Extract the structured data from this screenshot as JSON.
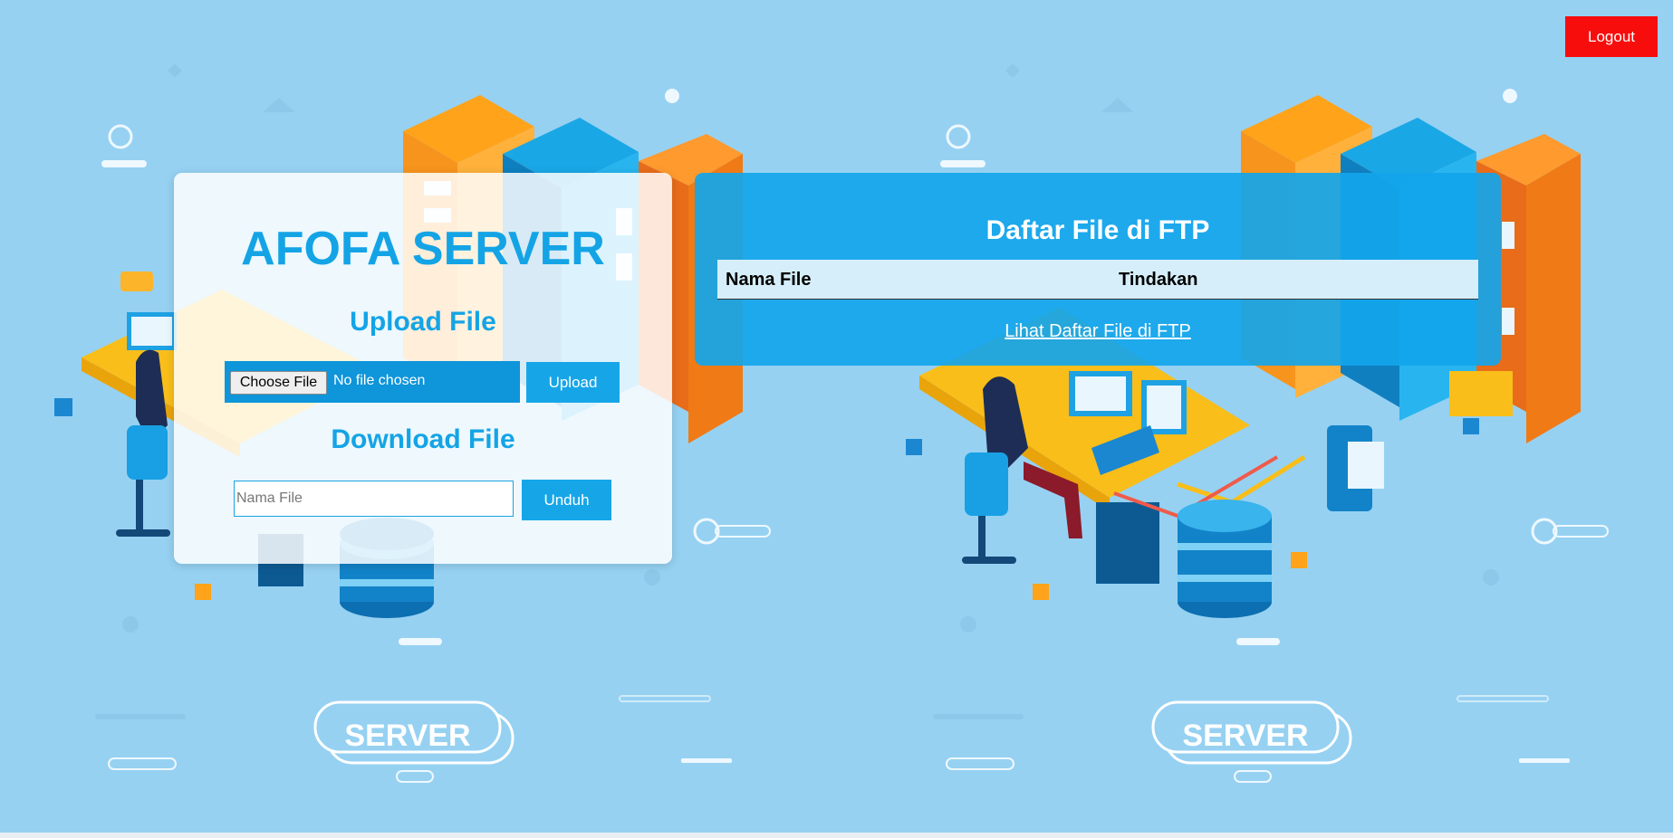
{
  "header": {
    "logout_label": "Logout"
  },
  "upload_panel": {
    "app_title": "AFOFA SERVER",
    "upload_title": "Upload File",
    "choose_file_label": "Choose File",
    "file_status": "No file chosen",
    "upload_button": "Upload",
    "download_title": "Download File",
    "filename_placeholder": "Nama File",
    "download_button": "Unduh"
  },
  "file_list_panel": {
    "title": "Daftar File di FTP",
    "columns": [
      "Nama File",
      "Tindakan"
    ],
    "link_text": "Lihat Daftar File di FTP"
  },
  "background": {
    "sign_text": "SERVER"
  },
  "colors": {
    "background": "#96d1f2",
    "accent": "#14a4e6",
    "logout": "#f80d0d",
    "panel_blue": "#12a5eb"
  }
}
